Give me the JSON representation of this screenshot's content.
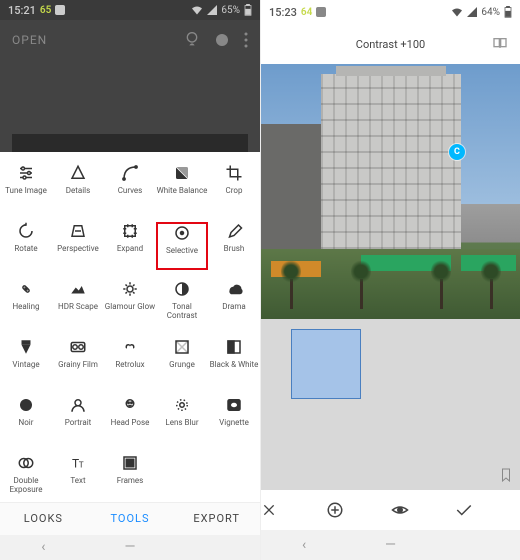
{
  "left": {
    "status": {
      "time": "15:21",
      "temp": "65",
      "battery": "65%"
    },
    "open_label": "OPEN",
    "tools": [
      {
        "label": "Tune Image",
        "name": "tune-image-tool"
      },
      {
        "label": "Details",
        "name": "details-tool"
      },
      {
        "label": "Curves",
        "name": "curves-tool"
      },
      {
        "label": "White Balance",
        "name": "white-balance-tool"
      },
      {
        "label": "Crop",
        "name": "crop-tool"
      },
      {
        "label": "Rotate",
        "name": "rotate-tool"
      },
      {
        "label": "Perspective",
        "name": "perspective-tool"
      },
      {
        "label": "Expand",
        "name": "expand-tool"
      },
      {
        "label": "Selective",
        "name": "selective-tool",
        "highlight": true
      },
      {
        "label": "Brush",
        "name": "brush-tool"
      },
      {
        "label": "Healing",
        "name": "healing-tool"
      },
      {
        "label": "HDR Scape",
        "name": "hdr-scape-tool"
      },
      {
        "label": "Glamour Glow",
        "name": "glamour-glow-tool"
      },
      {
        "label": "Tonal Contrast",
        "name": "tonal-contrast-tool"
      },
      {
        "label": "Drama",
        "name": "drama-tool"
      },
      {
        "label": "Vintage",
        "name": "vintage-tool"
      },
      {
        "label": "Grainy Film",
        "name": "grainy-film-tool"
      },
      {
        "label": "Retrolux",
        "name": "retrolux-tool"
      },
      {
        "label": "Grunge",
        "name": "grunge-tool"
      },
      {
        "label": "Black & White",
        "name": "black-white-tool"
      },
      {
        "label": "Noir",
        "name": "noir-tool"
      },
      {
        "label": "Portrait",
        "name": "portrait-tool"
      },
      {
        "label": "Head Pose",
        "name": "head-pose-tool"
      },
      {
        "label": "Lens Blur",
        "name": "lens-blur-tool"
      },
      {
        "label": "Vignette",
        "name": "vignette-tool"
      },
      {
        "label": "Double Exposure",
        "name": "double-exposure-tool"
      },
      {
        "label": "Text",
        "name": "text-tool"
      },
      {
        "label": "Frames",
        "name": "frames-tool"
      }
    ],
    "tabs": {
      "looks": "LOOKS",
      "tools": "TOOLS",
      "export": "EXPORT"
    }
  },
  "right": {
    "status": {
      "time": "15:23",
      "temp": "64",
      "battery": "64%"
    },
    "title": "Contrast +100",
    "marker_label": "C"
  },
  "tool_icons": {
    "tune-image-tool": "<svg viewBox='0 0 24 24' width='18' height='18' fill='none' stroke='currentColor' stroke-width='2'><line x1='4' y1='6' x2='20' y2='6'/><line x1='4' y1='12' x2='20' y2='12'/><line x1='4' y1='18' x2='20' y2='18'/><circle cx='8' cy='6' r='2' fill='#fff'/><circle cx='16' cy='12' r='2' fill='#fff'/><circle cx='10' cy='18' r='2' fill='#fff'/></svg>",
    "details-tool": "<svg viewBox='0 0 24 24' width='18' height='18' fill='none' stroke='currentColor' stroke-width='2'><polygon points='12,3 20,19 4,19'/></svg>",
    "curves-tool": "<svg viewBox='0 0 24 24' width='18' height='18' fill='none' stroke='currentColor' stroke-width='2'><path d='M4 20 Q4 4 20 4'/><circle cx='4' cy='20' r='1.5' fill='currentColor'/><circle cx='20' cy='4' r='1.5' fill='currentColor'/></svg>",
    "white-balance-tool": "<svg viewBox='0 0 24 24' width='18' height='18' fill='currentColor'><rect x='4' y='4' width='16' height='16' rx='2'/><path d='M4 4 L20 20' stroke='#fff' stroke-width='1'/><path d='M4 4 L20 4 L20 20 Z' fill='#fff' opacity='.5'/></svg>",
    "crop-tool": "<svg viewBox='0 0 24 24' width='18' height='18' fill='none' stroke='currentColor' stroke-width='2'><path d='M7 2 L7 17 L22 17'/><path d='M2 7 L17 7 L17 22'/></svg>",
    "rotate-tool": "<svg viewBox='0 0 24 24' width='18' height='18' fill='none' stroke='currentColor' stroke-width='2'><path d='M20 12 A8 8 0 1 1 12 4'/><polyline points='12,1 12,4 9,4'/></svg>",
    "perspective-tool": "<svg viewBox='0 0 24 24' width='18' height='18' fill='none' stroke='currentColor' stroke-width='2'><polygon points='7,5 17,5 20,19 4,19'/><line x1='8' y1='12' x2='16' y2='12'/></svg>",
    "expand-tool": "<svg viewBox='0 0 24 24' width='18' height='18' fill='none' stroke='currentColor' stroke-width='2'><rect x='5' y='5' width='14' height='14'/><path d='M9 3v4M15 3v4M9 17v4M15 17v4M3 9h4M3 15h4M17 9h4M17 15h4'/></svg>",
    "selective-tool": "<svg viewBox='0 0 24 24' width='18' height='18' fill='none' stroke='currentColor' stroke-width='2'><circle cx='12' cy='12' r='8'/><circle cx='12' cy='12' r='2' fill='currentColor'/></svg>",
    "brush-tool": "<svg viewBox='0 0 24 24' width='18' height='18' fill='none' stroke='currentColor' stroke-width='2'><path d='M18 4 L8 14 L6 20 L12 18 L22 8 Z'/></svg>",
    "healing-tool": "<svg viewBox='0 0 24 24' width='18' height='18' fill='none' stroke='currentColor' stroke-width='2'><rect x='7' y='10' width='10' height='4' rx='2' transform='rotate(45 12 12)'/><line x1='10' y1='10' x2='14' y2='14'/><line x1='14' y1='10' x2='10' y2='14'/></svg>",
    "hdr-scape-tool": "<svg viewBox='0 0 24 24' width='18' height='18' fill='currentColor'><polygon points='3,18 9,10 13,14 17,8 21,18'/></svg>",
    "glamour-glow-tool": "<svg viewBox='0 0 24 24' width='18' height='18' fill='none' stroke='currentColor' stroke-width='2'><circle cx='12' cy='12' r='4'/><path d='M12 3v3M12 18v3M3 12h3M18 12h3M6 6l2 2M16 16l2 2M18 6l-2 2M8 16l-2 2'/></svg>",
    "tonal-contrast-tool": "<svg viewBox='0 0 24 24' width='18' height='18'><circle cx='12' cy='12' r='8' fill='none' stroke='currentColor' stroke-width='2'/><path d='M12 4 A8 8 0 0 1 12 20 Z' fill='currentColor'/></svg>",
    "drama-tool": "<svg viewBox='0 0 24 24' width='18' height='18' fill='currentColor'><path d='M6 14 a5 5 0 0 1 5-5 a6 6 0 0 1 11 3 a4 4 0 0 1 -2 7 H8 a4 4 0 0 1 -2-5 Z'/></svg>",
    "vintage-tool": "<svg viewBox='0 0 24 24' width='18' height='18' fill='currentColor'><rect x='6' y='3' width='12' height='6'/><polygon points='6,9 18,9 12,21'/></svg>",
    "grainy-film-tool": "<svg viewBox='0 0 24 24' width='18' height='18' fill='none' stroke='currentColor' stroke-width='2'><rect x='3' y='6' width='18' height='12' rx='2'/><circle cx='8' cy='12' r='3'/><circle cx='16' cy='12' r='3'/></svg>",
    "retrolux-tool": "<svg viewBox='0 0 24 24' width='18' height='18' fill='currentColor'><path d='M6 12 Q6 8 10 8 Q12 8 12 10 Q12 8 14 8 Q18 8 18 12 Q18 14 16 14 L16 12 Q16 10 14 10 Q12 10 12 12 Q12 10 10 10 Q8 10 8 12 L8 14 Q6 14 6 12 Z'/></svg>",
    "grunge-tool": "<svg viewBox='0 0 24 24' width='18' height='18' fill='none' stroke='currentColor' stroke-width='2'><rect x='4' y='4' width='16' height='16'/><path d='M4 4 L20 20 M20 4 L4 20' opacity='.3'/></svg>",
    "black-white-tool": "<svg viewBox='0 0 24 24' width='18' height='18' fill='none' stroke='currentColor' stroke-width='2'><rect x='4' y='4' width='16' height='16'/><rect x='4' y='4' width='8' height='16' fill='currentColor'/></svg>",
    "noir-tool": "<svg viewBox='0 0 24 24' width='18' height='18' fill='currentColor'><circle cx='12' cy='12' r='8'/></svg>",
    "portrait-tool": "<svg viewBox='0 0 24 24' width='18' height='18' fill='none' stroke='currentColor' stroke-width='2'><circle cx='12' cy='9' r='4'/><path d='M4 21 a8 8 0 0 1 16 0'/></svg>",
    "head-pose-tool": "<svg viewBox='0 0 24 24' width='18' height='18' fill='none' stroke='currentColor' stroke-width='2'><circle cx='12' cy='10' r='5'/><circle cx='10' cy='9' r='1' fill='currentColor'/><circle cx='14' cy='9' r='1' fill='currentColor'/><path d='M10 12 Q12 14 14 12'/></svg>",
    "lens-blur-tool": "<svg viewBox='0 0 24 24' width='18' height='18' fill='none' stroke='currentColor' stroke-width='2'><circle cx='12' cy='12' r='3'/><circle cx='12' cy='12' r='7' stroke-dasharray='2 3'/></svg>",
    "vignette-tool": "<svg viewBox='0 0 24 24' width='18' height='18' fill='none' stroke='currentColor' stroke-width='2'><rect x='4' y='5' width='16' height='14' rx='2' fill='currentColor'/><ellipse cx='12' cy='12' rx='5' ry='4' fill='#fff'/></svg>",
    "double-exposure-tool": "<svg viewBox='0 0 24 24' width='18' height='18' fill='none' stroke='currentColor' stroke-width='2'><circle cx='9' cy='12' r='6'/><circle cx='15' cy='12' r='6'/></svg>",
    "text-tool": "<svg viewBox='0 0 24 24' width='18' height='18' fill='currentColor'><text x='4' y='18' font-size='16' font-family='serif'>T</text><text x='13' y='18' font-size='11' font-family='serif'>T</text></svg>",
    "frames-tool": "<svg viewBox='0 0 24 24' width='18' height='18' fill='none' stroke='currentColor' stroke-width='2'><rect x='4' y='4' width='16' height='16'/><rect x='7' y='7' width='10' height='10' fill='currentColor'/></svg>"
  }
}
